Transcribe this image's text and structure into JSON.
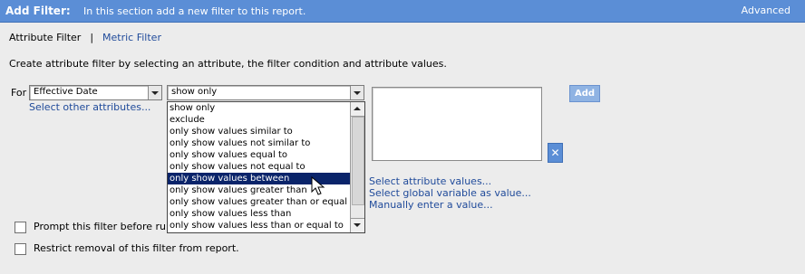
{
  "header": {
    "title": "Add Filter:",
    "description": "In this section add a new filter to this report.",
    "advanced_label": "Advanced"
  },
  "tabs": {
    "attribute_filter": "Attribute Filter",
    "separator": "|",
    "metric_filter": "Metric Filter"
  },
  "instructions": "Create attribute filter by selecting an attribute, the filter condition and attribute values.",
  "form": {
    "for_label": "For",
    "attribute_select": {
      "value": "Effective Date"
    },
    "condition_select": {
      "value": "show only"
    },
    "select_other_attributes": "Select other attributes...",
    "add_button": "Add",
    "clear_button": "✕"
  },
  "condition_options": [
    {
      "label": "show only",
      "selected": false
    },
    {
      "label": "exclude",
      "selected": false
    },
    {
      "label": "only show values similar to",
      "selected": false
    },
    {
      "label": "only show values not similar to",
      "selected": false
    },
    {
      "label": "only show values equal to",
      "selected": false
    },
    {
      "label": "only show values not equal to",
      "selected": false
    },
    {
      "label": "only show values between",
      "selected": true
    },
    {
      "label": "only show values greater than",
      "selected": false
    },
    {
      "label": "only show values greater than or equal to",
      "selected": false
    },
    {
      "label": "only show values less than",
      "selected": false
    },
    {
      "label": "only show values less than or equal to",
      "selected": false
    }
  ],
  "value_links": {
    "select_attribute_values": "Select attribute values...",
    "select_global_variable": "Select global variable as value...",
    "manually_enter": "Manually enter a value..."
  },
  "checkboxes": {
    "prompt_label": "Prompt this filter before running",
    "prompt_checked": false,
    "restrict_label": "Restrict removal of this filter from report.",
    "restrict_checked": false
  },
  "colors": {
    "header_bg": "#5b8ed6",
    "link": "#1f4a9a",
    "selection": "#0a246a",
    "add_button": "#8fb3e3"
  }
}
